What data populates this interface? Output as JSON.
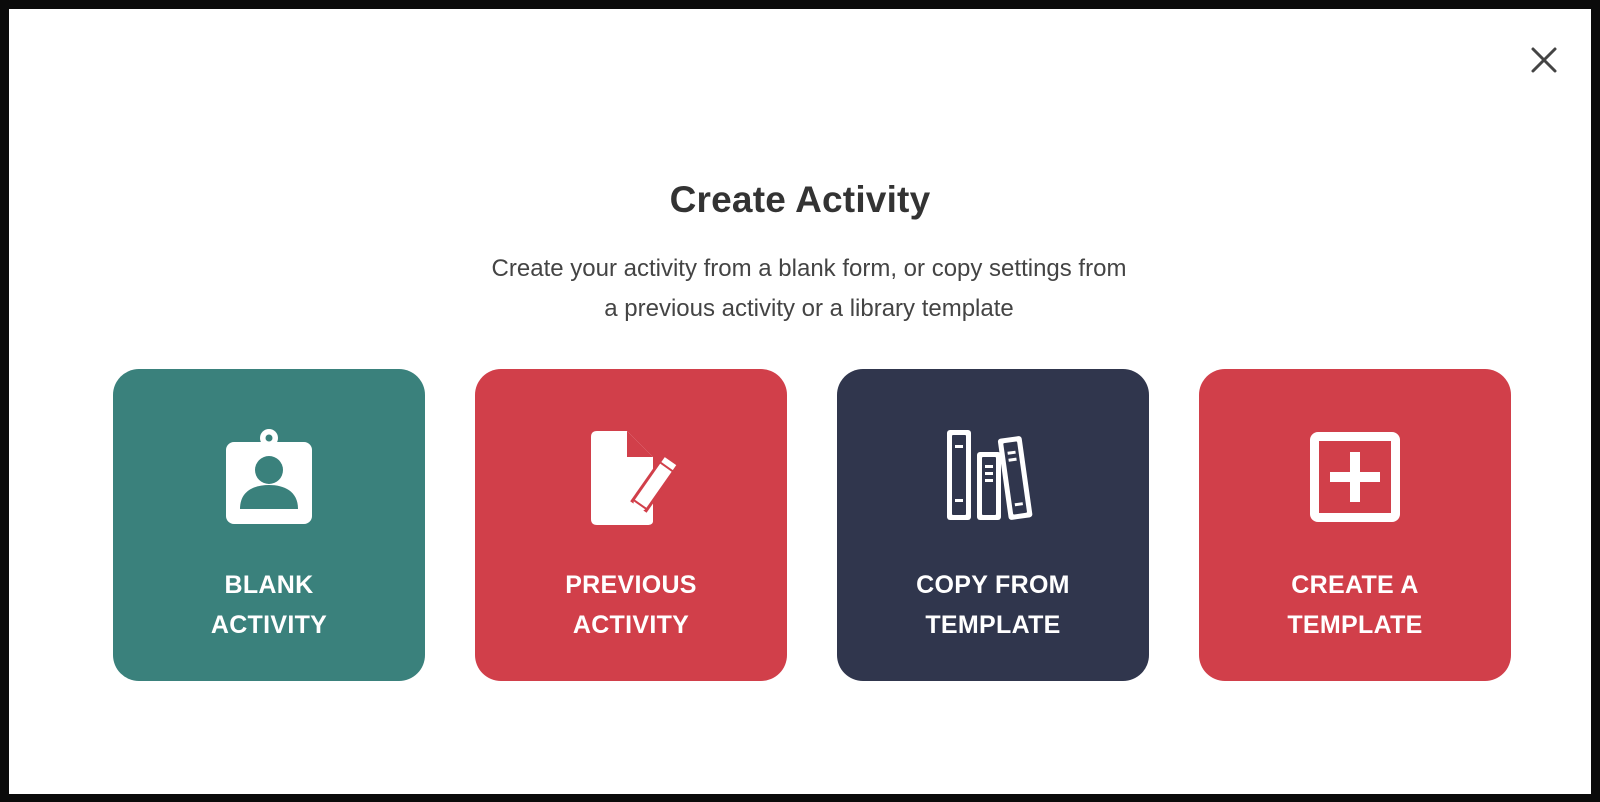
{
  "dialog": {
    "title": "Create Activity",
    "subtitle_line1": "Create your activity from a blank form, or copy settings from",
    "subtitle_line2": "a previous activity or a library template",
    "close_icon": "close-icon"
  },
  "options": [
    {
      "label_line1": "BLANK",
      "label_line2": "ACTIVITY",
      "icon": "id-badge-icon",
      "color": "#3a817c"
    },
    {
      "label_line1": "PREVIOUS",
      "label_line2": "ACTIVITY",
      "icon": "document-edit-icon",
      "color": "#d13f4a"
    },
    {
      "label_line1": "COPY FROM",
      "label_line2": "TEMPLATE",
      "icon": "books-icon",
      "color": "#30364d"
    },
    {
      "label_line1": "CREATE A",
      "label_line2": "TEMPLATE",
      "icon": "plus-square-icon",
      "color": "#d13f4a"
    }
  ]
}
